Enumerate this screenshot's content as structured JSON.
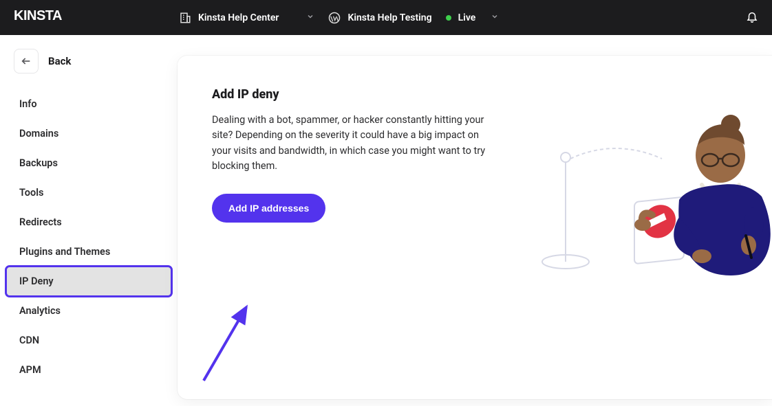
{
  "topbar": {
    "logo_text": "KINSTA",
    "company_selector": "Kinsta Help Center",
    "site_selector": "Kinsta Help Testing",
    "env_label": "Live"
  },
  "sidebar": {
    "back_label": "Back",
    "items": [
      {
        "label": "Info"
      },
      {
        "label": "Domains"
      },
      {
        "label": "Backups"
      },
      {
        "label": "Tools"
      },
      {
        "label": "Redirects"
      },
      {
        "label": "Plugins and Themes"
      },
      {
        "label": "IP Deny",
        "active": true
      },
      {
        "label": "Analytics"
      },
      {
        "label": "CDN"
      },
      {
        "label": "APM"
      }
    ]
  },
  "main": {
    "title": "Add IP deny",
    "description": "Dealing with a bot, spammer, or hacker constantly hitting your site? Depending on the severity it could have a big impact on your visits and bandwidth, in which case you might want to try blocking them.",
    "button_label": "Add IP addresses"
  },
  "colors": {
    "accent": "#5333ed",
    "topbar": "#1c1c1e",
    "live": "#3ecf4c"
  }
}
